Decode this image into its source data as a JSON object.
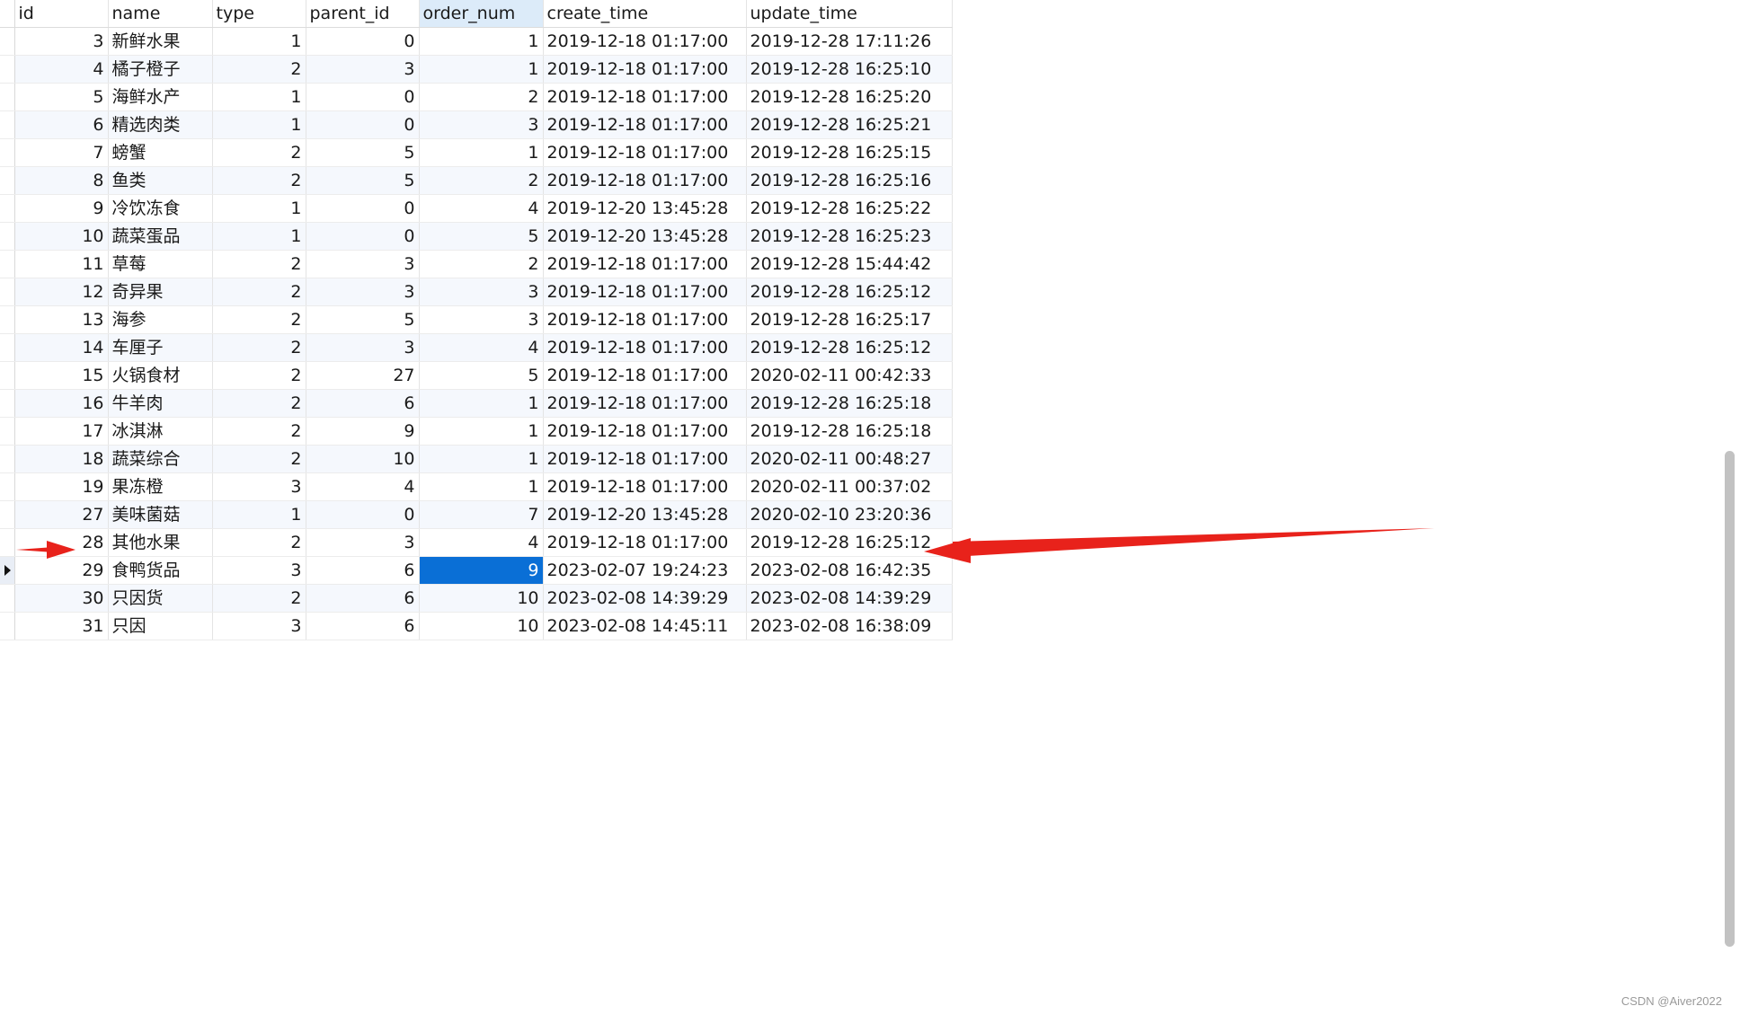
{
  "columns": [
    "id",
    "name",
    "type",
    "parent_id",
    "order_num",
    "create_time",
    "update_time"
  ],
  "rows": [
    [
      "3",
      "新鲜水果",
      "1",
      "0",
      "1",
      "2019-12-18 01:17:00",
      "2019-12-28 17:11:26"
    ],
    [
      "4",
      "橘子橙子",
      "2",
      "3",
      "1",
      "2019-12-18 01:17:00",
      "2019-12-28 16:25:10"
    ],
    [
      "5",
      "海鲜水产",
      "1",
      "0",
      "2",
      "2019-12-18 01:17:00",
      "2019-12-28 16:25:20"
    ],
    [
      "6",
      "精选肉类",
      "1",
      "0",
      "3",
      "2019-12-18 01:17:00",
      "2019-12-28 16:25:21"
    ],
    [
      "7",
      "螃蟹",
      "2",
      "5",
      "1",
      "2019-12-18 01:17:00",
      "2019-12-28 16:25:15"
    ],
    [
      "8",
      "鱼类",
      "2",
      "5",
      "2",
      "2019-12-18 01:17:00",
      "2019-12-28 16:25:16"
    ],
    [
      "9",
      "冷饮冻食",
      "1",
      "0",
      "4",
      "2019-12-20 13:45:28",
      "2019-12-28 16:25:22"
    ],
    [
      "10",
      "蔬菜蛋品",
      "1",
      "0",
      "5",
      "2019-12-20 13:45:28",
      "2019-12-28 16:25:23"
    ],
    [
      "11",
      "草莓",
      "2",
      "3",
      "2",
      "2019-12-18 01:17:00",
      "2019-12-28 15:44:42"
    ],
    [
      "12",
      "奇异果",
      "2",
      "3",
      "3",
      "2019-12-18 01:17:00",
      "2019-12-28 16:25:12"
    ],
    [
      "13",
      "海参",
      "2",
      "5",
      "3",
      "2019-12-18 01:17:00",
      "2019-12-28 16:25:17"
    ],
    [
      "14",
      "车厘子",
      "2",
      "3",
      "4",
      "2019-12-18 01:17:00",
      "2019-12-28 16:25:12"
    ],
    [
      "15",
      "火锅食材",
      "2",
      "27",
      "5",
      "2019-12-18 01:17:00",
      "2020-02-11 00:42:33"
    ],
    [
      "16",
      "牛羊肉",
      "2",
      "6",
      "1",
      "2019-12-18 01:17:00",
      "2019-12-28 16:25:18"
    ],
    [
      "17",
      "冰淇淋",
      "2",
      "9",
      "1",
      "2019-12-18 01:17:00",
      "2019-12-28 16:25:18"
    ],
    [
      "18",
      "蔬菜综合",
      "2",
      "10",
      "1",
      "2019-12-18 01:17:00",
      "2020-02-11 00:48:27"
    ],
    [
      "19",
      "果冻橙",
      "3",
      "4",
      "1",
      "2019-12-18 01:17:00",
      "2020-02-11 00:37:02"
    ],
    [
      "27",
      "美味菌菇",
      "1",
      "0",
      "7",
      "2019-12-20 13:45:28",
      "2020-02-10 23:20:36"
    ],
    [
      "28",
      "其他水果",
      "2",
      "3",
      "4",
      "2019-12-18 01:17:00",
      "2019-12-28 16:25:12"
    ],
    [
      "29",
      "食鸭货品",
      "3",
      "6",
      "9",
      "2023-02-07 19:24:23",
      "2023-02-08 16:42:35"
    ],
    [
      "30",
      "只因货",
      "2",
      "6",
      "10",
      "2023-02-08 14:39:29",
      "2023-02-08 14:39:29"
    ],
    [
      "31",
      "只因",
      "3",
      "6",
      "10",
      "2023-02-08 14:45:11",
      "2023-02-08 16:38:09"
    ]
  ],
  "current_row_index": 19,
  "selected_cell": {
    "row": 19,
    "column": "order_num"
  },
  "active_column": "order_num",
  "alternate_rows": [
    1,
    3,
    5,
    7,
    9,
    11,
    13,
    15,
    17,
    20
  ],
  "annotation_color": "#e8221b",
  "selection_color": "#0a6fd6",
  "watermark": "CSDN @Aiver2022"
}
